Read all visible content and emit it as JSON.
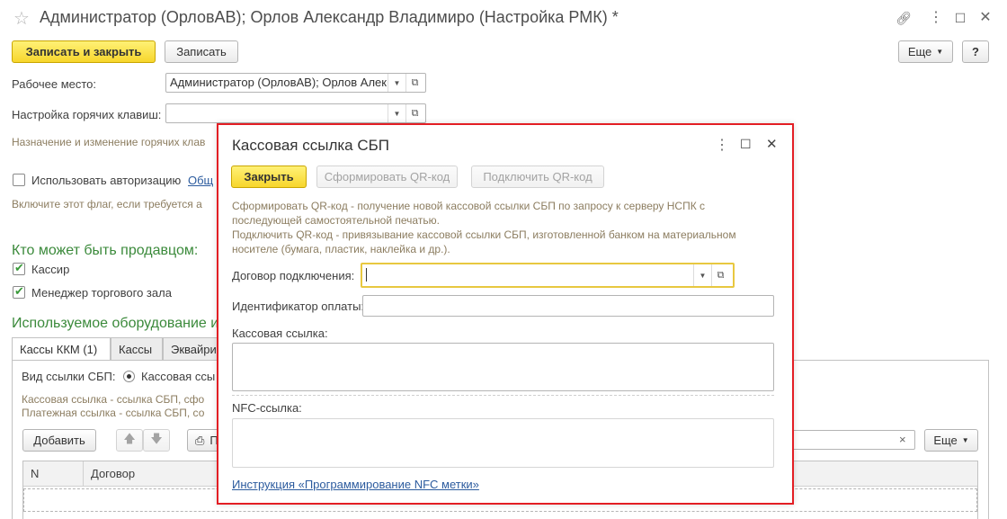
{
  "window": {
    "title": "Администратор (ОрловАВ); Орлов Александр Владимиро (Настройка РМК) *",
    "star_icon": "star-icon",
    "actions": [
      "link-icon",
      "more-icon",
      "maximize-icon",
      "close-icon"
    ]
  },
  "toolbar": {
    "save_close": "Записать и закрыть",
    "save": "Записать",
    "more": "Еще",
    "help": "?"
  },
  "form": {
    "workplace_label": "Рабочее место:",
    "workplace_value": "Администратор (ОрловАВ); Орлов Алек",
    "hotkeys_label": "Настройка горячих клавиш:",
    "hotkeys_value": "",
    "hotkeys_hint": "Назначение и изменение горячих клав",
    "auth_checkbox": "Использовать авторизацию",
    "auth_link": "Общ",
    "auth_hint": "Включите этот флаг, если требуется а",
    "sellers_heading": "Кто может быть продавцом:",
    "seller_cashier": "Кассир",
    "seller_manager": "Менеджер торгового зала",
    "equipment_heading": "Используемое оборудование и",
    "tabs": [
      "Кассы ККМ (1)",
      "Кассы",
      "Эквайри"
    ],
    "sbp_label": "Вид ссылки СБП:",
    "sbp_option": "Кассовая ссы",
    "sbp_hint1": "Кассовая ссылка - ссылка СБП, сфо",
    "sbp_hint2": "Платежная ссылка - ссылка СБП, со",
    "add_button": "Добавить",
    "up_icon": "arrow-up-icon",
    "down_icon": "arrow-down-icon",
    "print_icon": "print-icon",
    "print_label": "П",
    "more2": "Еще",
    "search_clear": "×",
    "col_n": "N",
    "col_contract": "Договор"
  },
  "dialog": {
    "title": "Кассовая ссылка СБП",
    "close_button": "Закрыть",
    "generate_qr": "Сформировать QR-код",
    "connect_qr": "Подключить QR-код",
    "desc1": "Сформировать QR-код - получение новой кассовой ссылки СБП по запросу к серверу НСПК с",
    "desc2": "последующей самостоятельной печатью.",
    "desc3": "Подключить QR-код - привязывание кассовой ссылки СБП, изготовленной банком на материальном",
    "desc4": "носителе (бумага, пластик, наклейка и др.).",
    "contract_label": "Договор подключения:",
    "contract_value": "",
    "payment_id_label": "Идентификатор оплаты:",
    "payment_id_value": "",
    "cash_link_label": "Кассовая ссылка:",
    "nfc_label": "NFC-ссылка:",
    "instruction_link": "Инструкция «Программирование NFC метки»"
  },
  "colors": {
    "accent_yellow": "#f7d62c",
    "dialog_border": "#e31e24",
    "green_heading": "#3b8a3b",
    "hint_text": "#8c7d60",
    "link": "#2c5b9e"
  }
}
